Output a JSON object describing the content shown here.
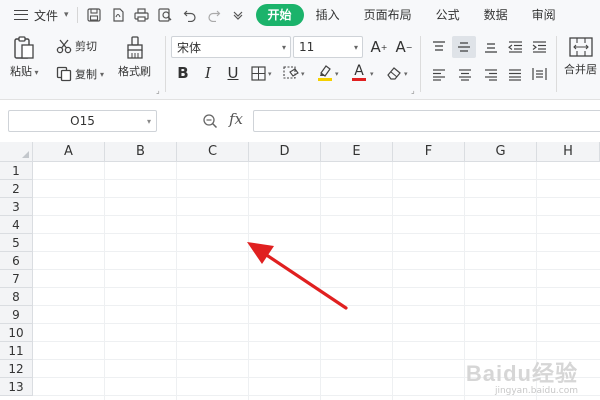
{
  "menubar": {
    "file_label": "文件",
    "tabs": [
      {
        "label": "开始",
        "active": true
      },
      {
        "label": "插入",
        "active": false
      },
      {
        "label": "页面布局",
        "active": false
      },
      {
        "label": "公式",
        "active": false
      },
      {
        "label": "数据",
        "active": false
      },
      {
        "label": "审阅",
        "active": false
      }
    ]
  },
  "ribbon": {
    "paste_label": "粘贴",
    "cut_label": "剪切",
    "copy_label": "复制",
    "format_painter_label": "格式刷",
    "font_name": "宋体",
    "font_size": "11",
    "merge_label": "合并居"
  },
  "formula_bar": {
    "cell_ref": "O15",
    "fx_label": "fx",
    "formula_value": ""
  },
  "sheet": {
    "columns": [
      "A",
      "B",
      "C",
      "D",
      "E",
      "F",
      "G",
      "H"
    ],
    "rows": [
      "1",
      "2",
      "3",
      "4",
      "5",
      "6",
      "7",
      "8",
      "9",
      "10",
      "11",
      "12",
      "13"
    ]
  },
  "watermark": {
    "logo": "Baidu经验",
    "url": "jingyan.baidu.com"
  },
  "colors": {
    "active_tab": "#1bb36b",
    "arrow": "#e02020",
    "font_color_bar": "#e02020",
    "highlight_bar": "#f5d000"
  }
}
